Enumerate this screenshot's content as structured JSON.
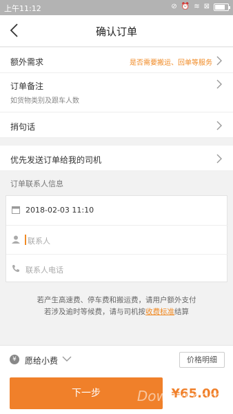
{
  "status_bar": {
    "time": "上午11:12"
  },
  "nav": {
    "title": "确认订单"
  },
  "rows": {
    "extra": {
      "label": "额外需求",
      "hint": "是否需要搬运、回单等服务"
    },
    "remark": {
      "label": "订单备注",
      "sub": "如货物类别及跟车人数"
    },
    "message": {
      "label": "捎句话"
    },
    "priority": {
      "label": "优先发送订单给我的司机"
    }
  },
  "contact": {
    "section_title": "订单联系人信息",
    "datetime": "2018-02-03 11:10",
    "name_placeholder": "联系人",
    "phone_placeholder": "联系人电话"
  },
  "notice": {
    "line1": "若产生高速费、停车费和搬运费，请用户额外支付",
    "line2_prefix": "若涉及逾时等候费，请与司机按",
    "line2_link": "收费标准",
    "line2_suffix": "结算"
  },
  "tip": {
    "label": "愿给小费",
    "detail_button": "价格明细",
    "yen_icon": "¥"
  },
  "bottom": {
    "next_button": "下一步",
    "price": "¥65.00",
    "watermark": "Downyi.com"
  },
  "colors": {
    "accent": "#f0802a",
    "statusbar": "#b3b3b3"
  },
  "battery_level": 0.8
}
